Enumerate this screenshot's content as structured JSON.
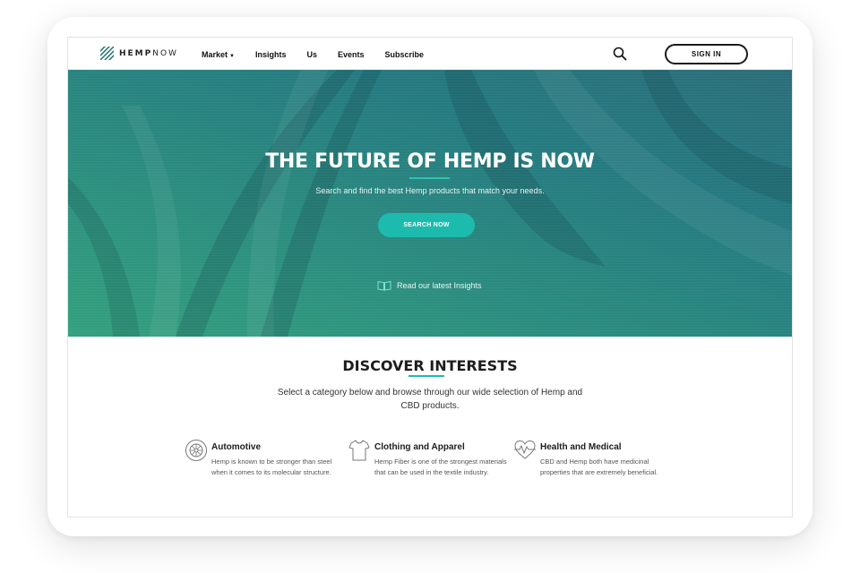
{
  "brand": {
    "name_bold": "HEMP",
    "name_light": "NOW"
  },
  "nav": {
    "links": [
      {
        "label": "Market",
        "has_caret": true
      },
      {
        "label": "Insights"
      },
      {
        "label": "Us"
      },
      {
        "label": "Events"
      },
      {
        "label": "Subscribe"
      }
    ],
    "caret": "▼",
    "sign_in": "SIGN IN"
  },
  "hero": {
    "title": "THE FUTURE OF HEMP IS NOW",
    "subtitle": "Search and find the best Hemp products that match your needs.",
    "button": "SEARCH NOW",
    "insights_link": "Read our latest Insights"
  },
  "discover": {
    "title": "DISCOVER INTERESTS",
    "description": "Select a category below and browse through our wide selection of Hemp and CBD products.",
    "categories": [
      {
        "icon": "tire-icon",
        "title": "Automotive",
        "text": "Hemp is known to be stronger than steel when it comes to its molecular structure."
      },
      {
        "icon": "tshirt-icon",
        "title": "Clothing and Apparel",
        "text": "Hemp Fiber is one of the strongest materials that can be used in the textile industry."
      },
      {
        "icon": "heartbeat-icon",
        "title": "Health and Medical",
        "text": "CBD and Hemp both have medicinal properties that are extremely beneficial."
      }
    ]
  },
  "colors": {
    "accent": "#1dbbae",
    "hero_top": "#2b6e7a",
    "hero_bottom": "#34a07e"
  }
}
